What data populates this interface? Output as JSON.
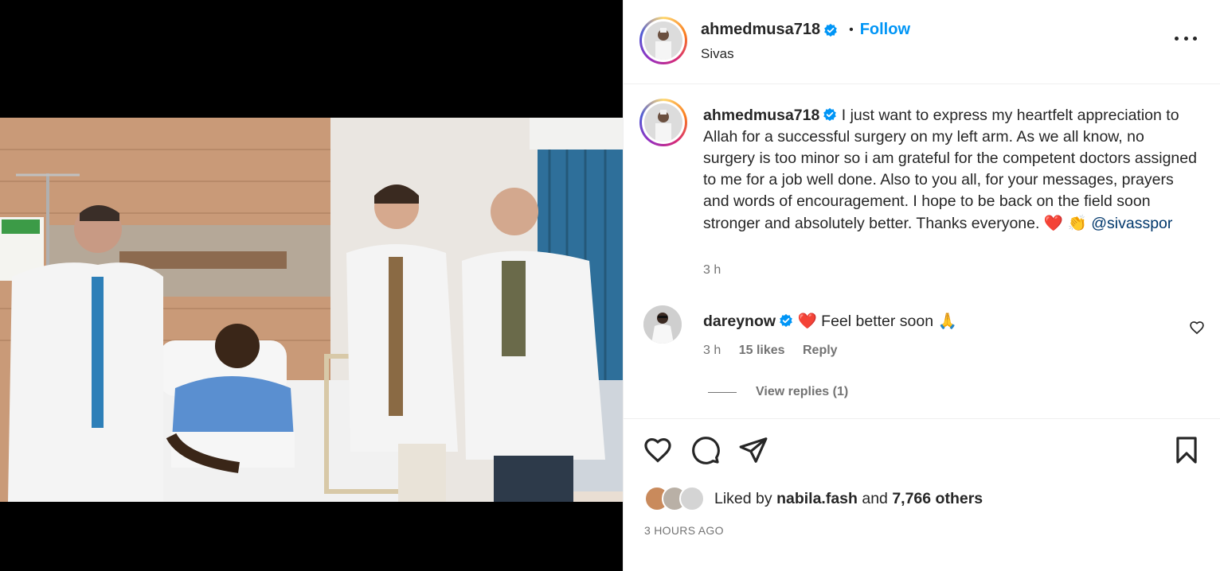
{
  "colors": {
    "accent_blue": "#0095f6",
    "mention_blue": "#00376b",
    "text": "#262626",
    "secondary": "#737373",
    "heart_red": "#ed4956"
  },
  "media": {
    "icon": "photo-of-hospital-room"
  },
  "header": {
    "username": "ahmedmusa718",
    "separator": "•",
    "follow_label": "Follow",
    "location": "Sivas",
    "more_icon": "more-horizontal-icon"
  },
  "caption": {
    "username": "ahmedmusa718",
    "text": "I just want to express my heartfelt appreciation to Allah for a successful surgery on my left arm. As we all know, no surgery is too minor so i am grateful for the competent doctors assigned to me for a job well done. Also to you all, for your messages, prayers and words of encouragement. I hope to be back on the field soon stronger and absolutely better. Thanks everyone.",
    "emoji_heart": "❤️",
    "emoji_clap": "👏",
    "mention": "@sivasspor",
    "time": "3 h"
  },
  "comment": {
    "username": "dareynow",
    "emoji_heart": "❤️",
    "text": "Feel better soon",
    "emoji_pray": "🙏",
    "time": "3 h",
    "likes": "15 likes",
    "reply_label": "Reply",
    "view_replies": "View replies (1)"
  },
  "actions": {
    "like_icon": "heart-icon",
    "comment_icon": "comment-icon",
    "share_icon": "send-icon",
    "save_icon": "bookmark-icon"
  },
  "likes": {
    "prefix": "Liked by",
    "user": "nabila.fash",
    "and": "and",
    "others": "7,766 others"
  },
  "timestamp": "3 HOURS AGO"
}
